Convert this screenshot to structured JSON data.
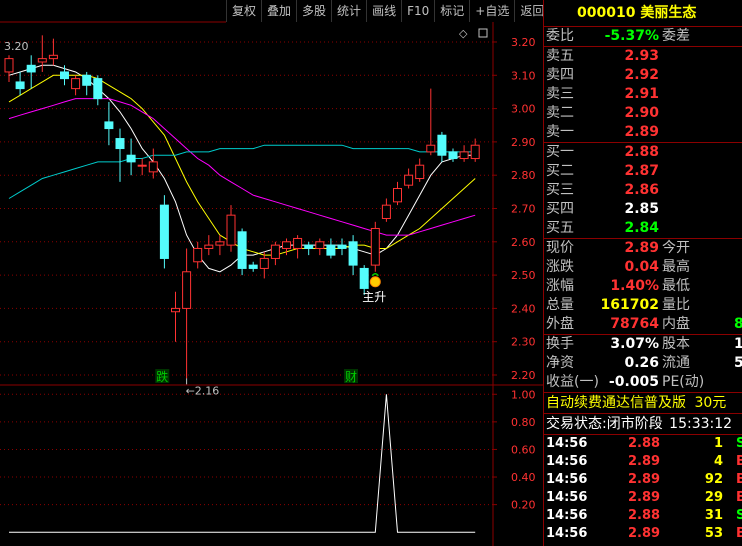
{
  "toolbar": [
    "复权",
    "叠加",
    "多股",
    "统计",
    "画线",
    "F10",
    "标记",
    "+自选",
    "返回"
  ],
  "stock": {
    "code": "000010",
    "name": "美丽生态"
  },
  "weibi": {
    "label": "委比",
    "value": "-5.37%",
    "label2": "委差"
  },
  "asks": [
    {
      "label": "卖五",
      "price": "2.93"
    },
    {
      "label": "卖四",
      "price": "2.92"
    },
    {
      "label": "卖三",
      "price": "2.91"
    },
    {
      "label": "卖二",
      "price": "2.90"
    },
    {
      "label": "卖一",
      "price": "2.89"
    }
  ],
  "bids": [
    {
      "label": "买一",
      "price": "2.88"
    },
    {
      "label": "买二",
      "price": "2.87"
    },
    {
      "label": "买三",
      "price": "2.86"
    },
    {
      "label": "买四",
      "price": "2.85"
    },
    {
      "label": "买五",
      "price": "2.84"
    }
  ],
  "quote": [
    {
      "label": "现价",
      "value": "2.89",
      "label2": "今开",
      "value2": ""
    },
    {
      "label": "涨跌",
      "value": "0.04",
      "label2": "最高",
      "value2": ""
    },
    {
      "label": "涨幅",
      "value": "1.40%",
      "label2": "最低",
      "value2": ""
    },
    {
      "label": "总量",
      "value": "161702",
      "label2": "量比",
      "value2": ""
    },
    {
      "label": "外盘",
      "value": "78764",
      "label2": "内盘",
      "value2": "8"
    }
  ],
  "fin": [
    {
      "label": "换手",
      "value": "3.07%",
      "label2": "股本",
      "value2": "1"
    },
    {
      "label": "净资",
      "value": "0.26",
      "label2": "流通",
      "value2": "5"
    },
    {
      "label": "收益(一)",
      "value": "-0.005",
      "label2": "PE(动)",
      "value2": ""
    }
  ],
  "promo": {
    "text": "自动续费通达信普及版",
    "price": "30元"
  },
  "status": {
    "label": "交易状态:",
    "phase": "闭市阶段",
    "time": "15:33:12"
  },
  "ticks": [
    {
      "time": "14:56",
      "price": "2.88",
      "vol": "1",
      "side": "S"
    },
    {
      "time": "14:56",
      "price": "2.89",
      "vol": "4",
      "side": "B"
    },
    {
      "time": "14:56",
      "price": "2.89",
      "vol": "92",
      "side": "B"
    },
    {
      "time": "14:56",
      "price": "2.89",
      "vol": "29",
      "side": "B"
    },
    {
      "time": "14:56",
      "price": "2.88",
      "vol": "31",
      "side": "S"
    },
    {
      "time": "14:56",
      "price": "2.89",
      "vol": "53",
      "side": "B"
    }
  ],
  "chart_data": [
    {
      "type": "candlestick",
      "y_ticks": [
        "3.20",
        "3.10",
        "3.00",
        "2.90",
        "2.80",
        "2.70",
        "2.60",
        "2.50",
        "2.40",
        "2.30",
        "2.20"
      ],
      "ylim": [
        2.17,
        3.26
      ],
      "top_left_label": "3.20",
      "low_annotation": "2.16",
      "signal_label": "主升",
      "event_markers": [
        "跌",
        "财"
      ],
      "candles": [
        {
          "o": 3.11,
          "c": 3.15,
          "h": 3.16,
          "l": 3.08
        },
        {
          "o": 3.08,
          "c": 3.06,
          "h": 3.11,
          "l": 3.04
        },
        {
          "o": 3.13,
          "c": 3.11,
          "h": 3.16,
          "l": 3.06
        },
        {
          "o": 3.14,
          "c": 3.15,
          "h": 3.22,
          "l": 3.11
        },
        {
          "o": 3.15,
          "c": 3.16,
          "h": 3.21,
          "l": 3.13
        },
        {
          "o": 3.11,
          "c": 3.09,
          "h": 3.13,
          "l": 3.07
        },
        {
          "o": 3.06,
          "c": 3.09,
          "h": 3.1,
          "l": 3.04
        },
        {
          "o": 3.1,
          "c": 3.07,
          "h": 3.11,
          "l": 3.04
        },
        {
          "o": 3.09,
          "c": 3.03,
          "h": 3.1,
          "l": 3.01
        },
        {
          "o": 2.96,
          "c": 2.94,
          "h": 3.02,
          "l": 2.89
        },
        {
          "o": 2.91,
          "c": 2.88,
          "h": 2.94,
          "l": 2.78
        },
        {
          "o": 2.86,
          "c": 2.84,
          "h": 2.91,
          "l": 2.8
        },
        {
          "o": 2.83,
          "c": 2.83,
          "h": 2.85,
          "l": 2.8
        },
        {
          "o": 2.81,
          "c": 2.84,
          "h": 2.88,
          "l": 2.79
        },
        {
          "o": 2.71,
          "c": 2.55,
          "h": 2.74,
          "l": 2.52
        },
        {
          "o": 2.39,
          "c": 2.4,
          "h": 2.45,
          "l": 2.3
        },
        {
          "o": 2.4,
          "c": 2.51,
          "h": 2.58,
          "l": 2.19
        },
        {
          "o": 2.54,
          "c": 2.58,
          "h": 2.6,
          "l": 2.52
        },
        {
          "o": 2.58,
          "c": 2.59,
          "h": 2.62,
          "l": 2.56
        },
        {
          "o": 2.59,
          "c": 2.6,
          "h": 2.62,
          "l": 2.56
        },
        {
          "o": 2.59,
          "c": 2.68,
          "h": 2.71,
          "l": 2.57
        },
        {
          "o": 2.63,
          "c": 2.52,
          "h": 2.64,
          "l": 2.5
        },
        {
          "o": 2.53,
          "c": 2.52,
          "h": 2.54,
          "l": 2.51
        },
        {
          "o": 2.52,
          "c": 2.55,
          "h": 2.57,
          "l": 2.49
        },
        {
          "o": 2.55,
          "c": 2.59,
          "h": 2.6,
          "l": 2.53
        },
        {
          "o": 2.58,
          "c": 2.6,
          "h": 2.61,
          "l": 2.56
        },
        {
          "o": 2.58,
          "c": 2.61,
          "h": 2.62,
          "l": 2.55
        },
        {
          "o": 2.59,
          "c": 2.58,
          "h": 2.6,
          "l": 2.56
        },
        {
          "o": 2.58,
          "c": 2.6,
          "h": 2.61,
          "l": 2.56
        },
        {
          "o": 2.59,
          "c": 2.56,
          "h": 2.61,
          "l": 2.55
        },
        {
          "o": 2.59,
          "c": 2.58,
          "h": 2.61,
          "l": 2.56
        },
        {
          "o": 2.6,
          "c": 2.53,
          "h": 2.62,
          "l": 2.5
        },
        {
          "o": 2.52,
          "c": 2.46,
          "h": 2.53,
          "l": 2.44
        },
        {
          "o": 2.53,
          "c": 2.64,
          "h": 2.66,
          "l": 2.51
        },
        {
          "o": 2.67,
          "c": 2.71,
          "h": 2.73,
          "l": 2.66
        },
        {
          "o": 2.72,
          "c": 2.76,
          "h": 2.78,
          "l": 2.71
        },
        {
          "o": 2.77,
          "c": 2.8,
          "h": 2.82,
          "l": 2.76
        },
        {
          "o": 2.79,
          "c": 2.83,
          "h": 2.85,
          "l": 2.78
        },
        {
          "o": 2.87,
          "c": 2.89,
          "h": 3.06,
          "l": 2.86
        },
        {
          "o": 2.92,
          "c": 2.86,
          "h": 2.93,
          "l": 2.84
        },
        {
          "o": 2.87,
          "c": 2.85,
          "h": 2.88,
          "l": 2.84
        },
        {
          "o": 2.85,
          "c": 2.87,
          "h": 2.89,
          "l": 2.84
        },
        {
          "o": 2.85,
          "c": 2.89,
          "h": 2.91,
          "l": 2.84
        }
      ],
      "ma": [
        {
          "name": "MA5",
          "color": "#ffffff",
          "values": [
            3.1,
            3.11,
            3.12,
            3.13,
            3.13,
            3.12,
            3.11,
            3.09,
            3.06,
            3.03,
            2.99,
            2.94,
            2.88,
            2.84,
            2.79,
            2.72,
            2.62,
            2.56,
            2.52,
            2.51,
            2.53,
            2.56,
            2.56,
            2.57,
            2.58,
            2.59,
            2.59,
            2.59,
            2.59,
            2.59,
            2.59,
            2.58,
            2.57,
            2.56,
            2.58,
            2.62,
            2.68,
            2.74,
            2.8,
            2.84,
            2.85,
            2.86,
            2.86
          ]
        },
        {
          "name": "MA10",
          "color": "#ffff00",
          "values": [
            3.02,
            3.04,
            3.06,
            3.08,
            3.1,
            3.1,
            3.1,
            3.1,
            3.09,
            3.07,
            3.05,
            3.03,
            3.0,
            2.96,
            2.92,
            2.85,
            2.78,
            2.72,
            2.67,
            2.62,
            2.6,
            2.58,
            2.57,
            2.56,
            2.56,
            2.57,
            2.58,
            2.58,
            2.58,
            2.58,
            2.58,
            2.59,
            2.59,
            2.58,
            2.58,
            2.6,
            2.62,
            2.64,
            2.67,
            2.7,
            2.73,
            2.76,
            2.79
          ]
        },
        {
          "name": "MA20",
          "color": "#ff00ff",
          "values": [
            2.97,
            2.98,
            2.99,
            3.0,
            3.01,
            3.02,
            3.03,
            3.03,
            3.03,
            3.03,
            3.02,
            3.01,
            2.99,
            2.97,
            2.94,
            2.91,
            2.88,
            2.85,
            2.83,
            2.8,
            2.78,
            2.76,
            2.74,
            2.73,
            2.72,
            2.71,
            2.7,
            2.69,
            2.68,
            2.67,
            2.66,
            2.65,
            2.64,
            2.63,
            2.62,
            2.62,
            2.62,
            2.63,
            2.64,
            2.65,
            2.66,
            2.67,
            2.68
          ]
        },
        {
          "name": "MA60",
          "color": "#00cccc",
          "values": [
            2.73,
            2.75,
            2.77,
            2.79,
            2.8,
            2.81,
            2.82,
            2.83,
            2.84,
            2.84,
            2.84,
            2.85,
            2.85,
            2.86,
            2.86,
            2.86,
            2.87,
            2.87,
            2.87,
            2.88,
            2.88,
            2.88,
            2.88,
            2.89,
            2.89,
            2.89,
            2.89,
            2.89,
            2.89,
            2.89,
            2.89,
            2.88,
            2.88,
            2.88,
            2.88,
            2.88,
            2.88,
            2.87,
            2.87,
            2.87,
            2.87,
            2.87,
            2.87
          ]
        }
      ]
    },
    {
      "type": "line",
      "y_ticks": [
        "1.00",
        "0.80",
        "0.60",
        "0.40",
        "0.20"
      ],
      "ylim": [
        -0.1,
        1.06
      ],
      "values": [
        0,
        0,
        0,
        0,
        0,
        0,
        0,
        0,
        0,
        0,
        0,
        0,
        0,
        0,
        0,
        0,
        0,
        0,
        0,
        0,
        0,
        0,
        0,
        0,
        0,
        0,
        0,
        0,
        0,
        0,
        0,
        0,
        0,
        0,
        1,
        0,
        0,
        0,
        0,
        0,
        0,
        0,
        0
      ]
    }
  ]
}
